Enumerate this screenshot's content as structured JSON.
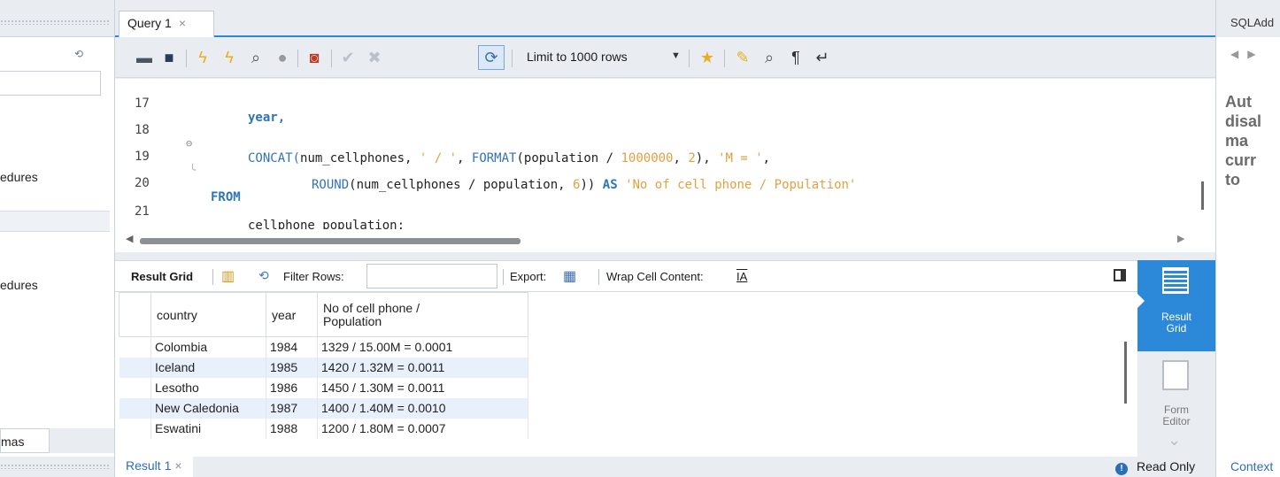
{
  "left_panel": {
    "item_procedures_1": "edures",
    "item_procedures_2": "edures",
    "bottom_tab": "mas"
  },
  "query_tab": {
    "label": "Query 1",
    "close": "×"
  },
  "toolbar": {
    "limit_label": "Limit to 1000 rows",
    "icons": [
      "open-folder-icon",
      "save-icon",
      "execute-icon",
      "execute-current-icon",
      "explain-icon",
      "stop-icon",
      "toggle-error-icon",
      "commit-icon",
      "rollback-icon",
      "autocommit-icon",
      "beautify-icon",
      "find-icon",
      "invisible-chars-icon",
      "word-wrap-icon",
      "snippet-star-icon"
    ]
  },
  "editor": {
    "lines": [
      {
        "num": "17",
        "code": "year,"
      },
      {
        "num": "18",
        "prefix": "CONCAT(",
        "a": "num_cellphones, ",
        "s1": "' / '",
        "b": ", ",
        "fmt": "FORMAT",
        "c": "(population / ",
        "n1": "1000000",
        "d": ", ",
        "n2": "2",
        "e": "), ",
        "s2": "'M = '",
        "f": ","
      },
      {
        "num": "19",
        "round": "ROUND",
        "a": "(num_cellphones / population, ",
        "n": "6",
        "b": ")) ",
        "as": "AS",
        "s": "'No of cell phone / Population'"
      },
      {
        "num": "20",
        "code": "FROM"
      },
      {
        "num": "21",
        "code": "cellphone_population;"
      }
    ]
  },
  "result_bar": {
    "result_grid": "Result Grid",
    "filter_rows": "Filter Rows:",
    "filter_value": "",
    "export": "Export:",
    "wrap": "Wrap Cell Content:"
  },
  "grid": {
    "columns": [
      "country",
      "year",
      "No of cell phone /\nPopulation"
    ],
    "rows": [
      [
        "Colombia",
        "1984",
        "1329 / 15.00M = 0.0001"
      ],
      [
        "Iceland",
        "1985",
        "1420 / 1.32M = 0.0011"
      ],
      [
        "Lesotho",
        "1986",
        "1450 / 1.30M = 0.0011"
      ],
      [
        "New Caledonia",
        "1987",
        "1400 / 1.40M = 0.0010"
      ],
      [
        "Eswatini",
        "1988",
        "1200 / 1.80M = 0.0007"
      ]
    ]
  },
  "side_tabs": {
    "result_grid": "Result\nGrid",
    "form_editor": "Form\nEditor"
  },
  "status": {
    "result_tab": "Result 1",
    "close": "×",
    "read_only": "Read Only"
  },
  "right_panel": {
    "title": "SQLAdd",
    "message": "Aut\ndisal\nma\ncurr\nto",
    "context": "Context"
  },
  "colors": {
    "accent": "#2c88d8",
    "keyword": "#2e75b8",
    "string": "#e2a13f",
    "row_alt": "#e8f0fb"
  }
}
